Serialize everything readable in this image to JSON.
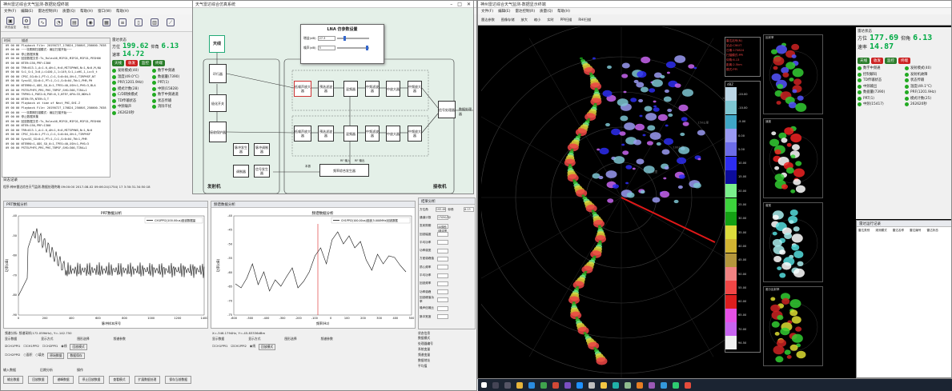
{
  "left_window": {
    "title": "神州雷达综合天气监测-数据处理终端",
    "menu": [
      "文件(F)",
      "编辑(E)",
      "雷达控制(R)",
      "质量(Q)",
      "帮助(H)",
      "窗口(W)",
      "帮助(H)"
    ],
    "toolbar": [
      "状态监控",
      "标定",
      "",
      "",
      "",
      "",
      "",
      "",
      "",
      "",
      "",
      "",
      "",
      "",
      "",
      "",
      "",
      ""
    ],
    "log_headers": [
      "时间",
      "描述"
    ],
    "log_lines": [
      "09 00 00  Playback File: 20190727_170824_2500US_250000.7038",
      "09 00 00  ~~~非周期扫描模式：扇区扫描开始~~~",
      "09 00 00  停止数据采集",
      "09 00 00  回放数据文件:Ts_Rulex46,MIFO1,MIFO1,MIFO1,PESH66",
      "09 00 00  NTER=150,PRF=1300",
      "09 00 00  TRR=013.1,A=1.6,AH=1,H=0,MITSPHWS,N=1,N=0,M,NA",
      "09 00 00  S=1_S=1_3=0,L=14X0,1,1=149,S=1,LxHS,1,Lx=5_t",
      "09 00 00  CPSC_SG=0=1,PT=1,C=1,S=0=04,XH=1,TIRPHSF,NT",
      "09 00 00  SyncSG_SG=0=1,PT=1,C=1,S=0=04,TW=1,PHR,PH",
      "09 00 00  NTERR0=1,ODS_SO_0=1,TPES=40,XSH=1,PHS=3,BLA",
      "09 00 00  PSTELPHFS,PRS,PHS,TBPSF,SHS=300,TIRA+1",
      "09 00 00  TRPHS=1,POE2=0,POE=6,3,NTEY,OPA=33,NDH+5",
      "09 00 00  NTER=TR,NTER=3,T",
      "09 00 00  Playback at time of Next_PHI,SHI.Z",
      "09 00 00  Playback File: 20190727_170824_2500US_250000.7038",
      "09 00 00  ~~~非周期扫描模式：扇区扫描开始~~~",
      "09 00 00  停止数据采集",
      "09 00 00  回放数据文件:Ts_Rulex46,MIFO1,MIFO1,MIFO1,PESH66",
      "09 00 00  NTER=150,PRF=1300",
      "09 00 00  TRR=013.1,A=1.6,AH=1,H=0,MITSPHWS,N=1,N=0",
      "09 00 00  CPSC_SG=0=1,PT=1,C=1,S=0=04,XH=1,TIRPHSF",
      "09 00 00  SyncSG_SG=0=1,PT=1,C=1,S=0=04,TW=1,PHR",
      "09 00 00  NTERR0=1,ODS_SO_0=1,TPES=40,XSH=1,PHS=3",
      "09 00 00  PSTELPHFS,PRS,PHS,TBPSF,SHS=300,TIRA+1"
    ],
    "status_label": "雷达状态",
    "az_label": "方位",
    "az_value": "199.62",
    "el_label": "仰角",
    "el_value": "6.13",
    "speed_label": "速率",
    "speed_value": "14.72",
    "buttons": [
      "天线",
      "收发",
      "监控",
      "终端"
    ],
    "stats_left": [
      "发射模式(40)",
      "温度(49.0°C)",
      "PRF(1201.9Hz)",
      "模式计数(28)",
      "C/D转换模式",
      "TD传输状态",
      "中频噪声",
      "262620秒"
    ],
    "stats_right": [
      "数字中频通",
      "数据量(7390)",
      "PRT(1)",
      "中频(15828)",
      "数字中频通道",
      "状态传输",
      "消除干扰"
    ],
    "log_footer": "日志记录",
    "status_bar": "程序:神州雷达综合天气监测-数据处理终端   09:00:00 2017-08-02 09:06:24(1754) 17 3:30:31.34:50:18",
    "chart1_tab": "PRT数据分析",
    "chart1_title": "PRT数据分析",
    "chart1_legend": "CH1PPI2(100.00us)回波数据量",
    "chart1_xlabel": "脉冲样本序号",
    "chart1_ylabel": "功率(dB)",
    "chart2_tab": "频谱数据分析",
    "chart2_title": "频谱数据分析",
    "chart2_legend": "CH1PPI2(100.00us)回波(5.000MHz)回波数据",
    "chart2_xlabel": "频率(Hz)",
    "chart2_ylabel": "功率(dB)",
    "result_title": "结果分析",
    "result_rows": [
      [
        "方位角",
        "193.49",
        "仰角",
        "6.13"
      ],
      [
        "通道计数",
        "17050/32",
        ""
      ],
      [
        "发射周期",
        "40微秒(脉冲宽度)",
        ""
      ],
      [
        "回波幅度",
        ""
      ],
      [
        "平均功率",
        ""
      ],
      [
        "功率谱宽",
        ""
      ],
      [
        "方差谱峰值",
        ""
      ],
      [
        "质心频率",
        ""
      ],
      [
        "平均功率",
        ""
      ],
      [
        "回波频率",
        ""
      ],
      [
        "功率谱峰",
        ""
      ],
      [
        "回波峰值功率",
        ""
      ],
      [
        "噪声信噪比",
        ""
      ],
      [
        "脉冲宽度",
        ""
      ]
    ],
    "readout1": "频谱分析:  频谱采样(172.059kHz), Y=-142.750",
    "readout2": "X=-346.1794Hz, Y=-45.83336dBm",
    "ctrl_labels": [
      "显示数据",
      "显示方式",
      "图形选择",
      "频谱参数"
    ],
    "check_a": [
      "CH1PPI1",
      "CH1PPI2",
      "CH2PPI1",
      "CH2PPI2"
    ],
    "radio_a": [
      "线",
      "面积",
      "填充"
    ],
    "btn_a": [
      "回放模式",
      "原始数据",
      "数据保存"
    ],
    "input_label": "输入数据",
    "output_label": "后期分析",
    "op_label": "操作",
    "bottom_buttons": [
      "输出数据",
      "回放数据",
      "谱峰数据",
      "停止回放数据",
      "查看模式",
      "扩展数据处理",
      "保存当前数据"
    ],
    "inner_stats_title": "状态信息",
    "inner_stats": [
      "数据模式",
      "处理器编号",
      "系统变量",
      "频谱变量",
      "数据地址",
      "平均值"
    ]
  },
  "diagram_window": {
    "title": "天气雷达综合仿真系统",
    "lna_title": "LNA 仿参数设置",
    "gain_label": "增益(dB)",
    "gain_value": "27.3",
    "nf_label": "噪声(dB)",
    "nf_value": "5",
    "antenna": "天线",
    "transmitter": "发射机",
    "receiver": "接收机",
    "blocks_tx": [
      "环行器",
      "极化开关",
      "接收保护器",
      "脉冲发生器",
      "脉冲调制器",
      "调制器",
      "信号发生器"
    ],
    "blocks_rx": [
      "低噪声放大器",
      "预选滤波器",
      "混频器",
      "中频滤波器",
      "中放大器",
      "中频放大器",
      "信号处理器"
    ],
    "synth": "频率综合发生器",
    "tag_lo": "本振",
    "tag_rf": "RF 输入",
    "tag_rf2": "RF 输出",
    "signal_out": "数据处理器"
  },
  "right_window": {
    "title": "神州雷达综合天气监测-数据显示终端",
    "menu": [
      "文件(F)",
      "编辑(E)",
      "雷达控制(R)",
      "质量(Q)",
      "帮助(H)"
    ],
    "toolbar": [
      "雷达参数",
      "图像存储",
      "放大",
      "缩小",
      "实时",
      "PPI扫描",
      "RHI扫描"
    ],
    "info_box": [
      "雷达站号(N)",
      "站点:CWUT",
      "日期:170824",
      "扫描模式:PPI",
      "仰角:6.13",
      "距离:2.5km",
      "模式:PPI"
    ],
    "legend_title": "dBZ",
    "legend": [
      [
        "-20.00",
        "#bcd6e6"
      ],
      [
        "-10.00",
        "#7ec6d2"
      ],
      [
        "-5.00",
        "#3fa6c6"
      ],
      [
        "0.00",
        "#9a9af2"
      ],
      [
        "5.00",
        "#6c6ce8"
      ],
      [
        "10.00",
        "#2d2df0"
      ],
      [
        "15.00",
        "#0c0c9c"
      ],
      [
        "20.00",
        "#7af08c"
      ],
      [
        "25.00",
        "#3cd23c"
      ],
      [
        "30.00",
        "#14a014"
      ],
      [
        "35.00",
        "#dcdc3c"
      ],
      [
        "40.00",
        "#d2b432"
      ],
      [
        "45.00",
        "#b4963c"
      ],
      [
        "50.00",
        "#f08282"
      ],
      [
        "55.00",
        "#f04646"
      ],
      [
        "60.00",
        "#dc1e1e"
      ],
      [
        "65.00",
        "#e650e6"
      ],
      [
        "70.00",
        "#c864f0"
      ],
      [
        "94.50",
        "#f0f0f0"
      ]
    ],
    "range_labels": [
      "50公里",
      "100公里",
      "150公里",
      "200公里",
      "250公里"
    ],
    "thumb_labels": [
      "反射率",
      "速度",
      "谱宽",
      "差分反射率"
    ],
    "status_label": "雷达状态",
    "az_label": "方位",
    "az_value": "177.69",
    "el_label": "仰角",
    "el_value": "6.13",
    "speed_label": "速率",
    "speed_value": "14.87",
    "buttons": [
      "天线",
      "收发",
      "监控",
      "终端"
    ],
    "stats_left": [
      "数字中频通",
      "控制解码",
      "TD传输状态",
      "中频输出",
      "数据量(7390)",
      "PRT(1)",
      "中频(15417)"
    ],
    "stats_right": [
      "发射模式(40)",
      "发射机故障",
      "状态传输",
      "温度(49.1°C)",
      "PRF(1201.9Hz)",
      "模式计数(25)",
      "262620秒"
    ],
    "msg_title": "雷达运行记录",
    "msg_cols": [
      "雷达类别",
      "观测模式",
      "雷达名称",
      "雷达编号",
      "雷达状态"
    ]
  }
}
